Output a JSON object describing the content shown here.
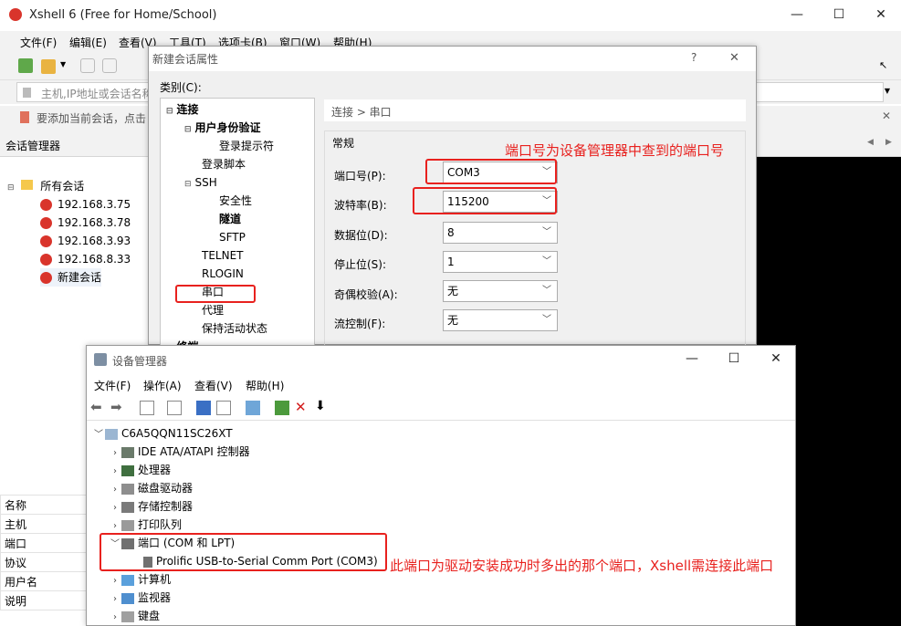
{
  "xshell": {
    "title": "Xshell 6 (Free for Home/School)",
    "menu": [
      "文件(F)",
      "编辑(E)",
      "查看(V)",
      "工具(T)",
      "选项卡(B)",
      "窗口(W)",
      "帮助(H)"
    ],
    "address_placeholder": "主机,IP地址或会话名称",
    "hint_text": "要添加当前会话，点击",
    "session_manager_title": "会话管理器",
    "sessions_root": "所有会话",
    "sessions": [
      "192.168.3.75",
      "192.168.3.78",
      "192.168.3.93",
      "192.168.8.33",
      "新建会话"
    ],
    "props_labels": [
      "名称",
      "主机",
      "端口",
      "协议",
      "用户名",
      "说明"
    ]
  },
  "dialog": {
    "title": "新建会话属性",
    "help": "?",
    "close": "✕",
    "category_label": "类别(C):",
    "breadcrumb": "连接 > 串口",
    "group_title": "常规",
    "tree": [
      {
        "label": "连接",
        "bold": true
      },
      {
        "label": "用户身份验证",
        "bold": true
      },
      {
        "label": "登录提示符",
        "bold": false
      },
      {
        "label": "登录脚本",
        "bold": false
      },
      {
        "label": "SSH",
        "bold": false
      },
      {
        "label": "安全性",
        "bold": false
      },
      {
        "label": "隧道",
        "bold": true
      },
      {
        "label": "SFTP",
        "bold": false
      },
      {
        "label": "TELNET",
        "bold": false
      },
      {
        "label": "RLOGIN",
        "bold": false
      },
      {
        "label": "串口",
        "bold": false
      },
      {
        "label": "代理",
        "bold": false
      },
      {
        "label": "保持活动状态",
        "bold": false
      },
      {
        "label": "终端",
        "bold": true
      }
    ],
    "fields": [
      {
        "label": "端口号(P):",
        "value": "COM3"
      },
      {
        "label": "波特率(B):",
        "value": "115200"
      },
      {
        "label": "数据位(D):",
        "value": "8"
      },
      {
        "label": "停止位(S):",
        "value": "1"
      },
      {
        "label": "奇偶校验(A):",
        "value": "无"
      },
      {
        "label": "流控制(F):",
        "value": "无"
      }
    ],
    "annotation": "端口号为设备管理器中查到的端口号"
  },
  "devmgr": {
    "title": "设备管理器",
    "menu": [
      "文件(F)",
      "操作(A)",
      "查看(V)",
      "帮助(H)"
    ],
    "computer": "C6A5QQN11SC26XT",
    "items": [
      "IDE ATA/ATAPI 控制器",
      "处理器",
      "磁盘驱动器",
      "存储控制器",
      "打印队列",
      "端口 (COM 和 LPT)",
      "Prolific USB-to-Serial Comm Port (COM3)",
      "计算机",
      "监视器",
      "键盘"
    ],
    "annotation": "此端口为驱动安装成功时多出的那个端口，Xshell需连接此端口"
  },
  "colors": {
    "accent": "#e8211e",
    "titlebar": "#ffffff",
    "dialog_bg": "#f0f0f0"
  }
}
